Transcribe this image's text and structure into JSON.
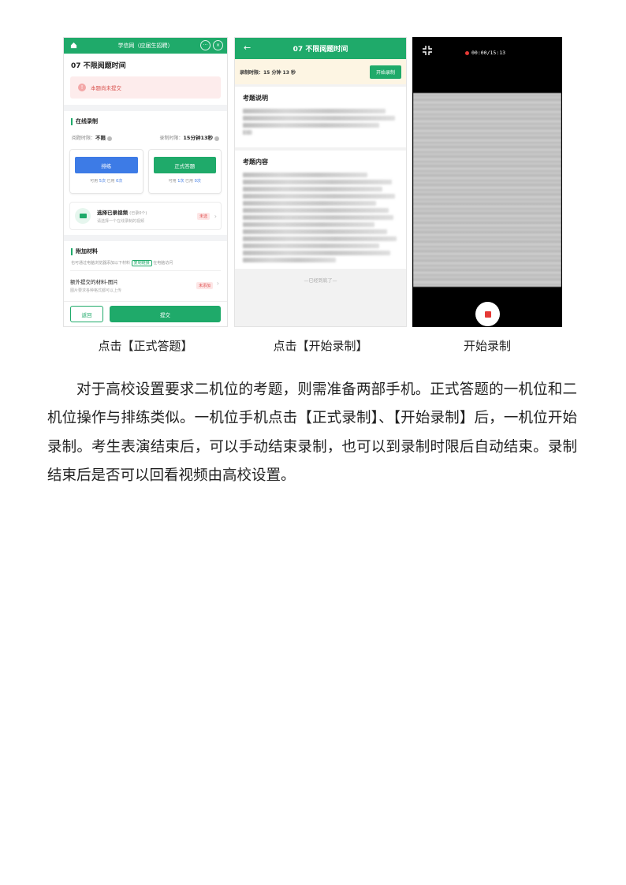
{
  "screen1": {
    "header_title": "学信网（应届生招聘）",
    "cap_more": "···",
    "cap_close": "×",
    "question_title": "07 不限阅题时间",
    "alert_text": "本题尚未提交",
    "section_online": "在线录制",
    "reading_time_label": "阅题时限：",
    "reading_time_value": "不限",
    "record_time_label": "录制时限：",
    "record_time_value": "15分钟13秒",
    "rehearsal_button": "排练",
    "formal_button": "正式答题",
    "rehearsal_stats": {
      "avail_label": "可用",
      "avail": "5次",
      "used_label": "已用",
      "used": "0次"
    },
    "formal_stats": {
      "avail_label": "可用",
      "avail": "1次",
      "used_label": "已用",
      "used": "0次"
    },
    "video_title": "选择已录视频",
    "video_count": "(已录0个)",
    "video_sub": "请选择一个在线录制的视频",
    "video_tag": "未选",
    "section_attach": "附加材料",
    "attach_note_pre": "也可通过电脑浏览器添加以下材料",
    "attach_note_link": "复制链接",
    "attach_note_post": "在电脑访问",
    "extra_title": "额外提交的材料-图片",
    "extra_sub": "图片要求各种格式都可以上传",
    "extra_tag": "未添加",
    "back_button": "返回",
    "submit_button": "提交"
  },
  "screen2": {
    "header_title": "07 不限阅题时间",
    "back_arrow": "←",
    "timer_text": "录制时限：15 分钟 13 秒",
    "start_button": "开始录制",
    "desc_heading": "考题说明",
    "content_heading": "考题内容",
    "end_note": "—已经到底了—"
  },
  "screen3": {
    "record_time": "00:00/15:13"
  },
  "captions": [
    "点击【正式答题】",
    "点击【开始录制】",
    "开始录制"
  ],
  "paragraph": "对于高校设置要求二机位的考题，则需准备两部手机。正式答题的一机位和二机位操作与排练类似。一机位手机点击【正式录制】、【开始录制】后，一机位开始录制。考生表演结束后，可以手动结束录制，也可以到录制时限后自动结束。录制结束后是否可以回看视频由高校设置。"
}
